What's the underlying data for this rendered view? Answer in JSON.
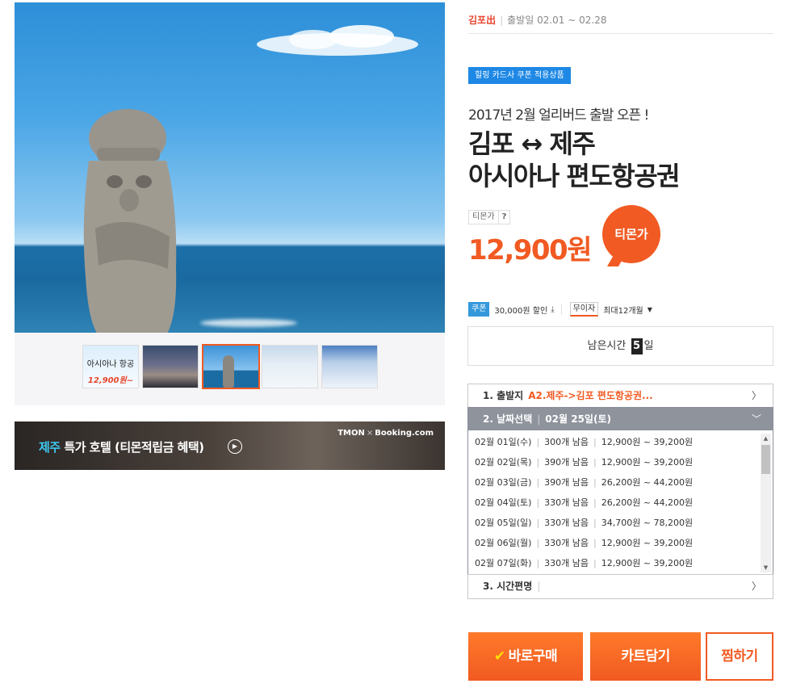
{
  "header": {
    "departure": "김포出",
    "date_range": "출발일 02.01 ~ 02.28"
  },
  "coupon_tag": "힐링 카드사 쿠폰 적용상품",
  "subtitle": "2017년 2월 얼리버드 출발 오픈 !",
  "title_line1": "김포 ↔ 제주",
  "title_line2": "아시아나 편도항공권",
  "price": {
    "label": "티몬가",
    "help": "?",
    "amount": "12,900원",
    "badge": "티몬가"
  },
  "benefits": {
    "coupon_badge": "쿠폰",
    "discount": "30,000원 할인",
    "download_icon": "download-icon",
    "installment_badge": "무이자",
    "installment": "최대12개월"
  },
  "timer": {
    "label": "남은시간",
    "value": "5",
    "unit": "일"
  },
  "options": [
    {
      "step": "1. 출발지",
      "value": "A2.제주->김포 편도항공권..."
    },
    {
      "step": "2. 날짜선택",
      "value": "02월 25일(토)"
    },
    {
      "step": "3. 시간편명",
      "value": ""
    }
  ],
  "dates": [
    {
      "date": "02월 01일(수)",
      "seats": "300개 남음",
      "range": "12,900원 ~ 39,200원"
    },
    {
      "date": "02월 02일(목)",
      "seats": "390개 남음",
      "range": "12,900원 ~ 39,200원"
    },
    {
      "date": "02월 03일(금)",
      "seats": "390개 남음",
      "range": "26,200원 ~ 44,200원"
    },
    {
      "date": "02월 04일(토)",
      "seats": "330개 남음",
      "range": "26,200원 ~ 44,200원"
    },
    {
      "date": "02월 05일(일)",
      "seats": "330개 남음",
      "range": "34,700원 ~ 78,200원"
    },
    {
      "date": "02월 06일(월)",
      "seats": "330개 남음",
      "range": "12,900원 ~ 39,200원"
    },
    {
      "date": "02월 07일(화)",
      "seats": "330개 남음",
      "range": "12,900원 ~ 39,200원"
    }
  ],
  "buttons": {
    "buy": "바로구매",
    "cart": "카트담기",
    "wish": "찜하기"
  },
  "thumbnail1": {
    "title": "아시아나 항공",
    "price": "12,900원~"
  },
  "banner": {
    "highlight": "제주",
    "text": " 특가 호텔 (티몬적립금 혜택)",
    "brand_left": "TMON",
    "brand_x": "×",
    "brand_right": "Booking.com"
  },
  "colors": {
    "accent": "#f15a22",
    "coupon_blue": "#1e88e5",
    "banner_highlight": "#3ec9f0"
  }
}
